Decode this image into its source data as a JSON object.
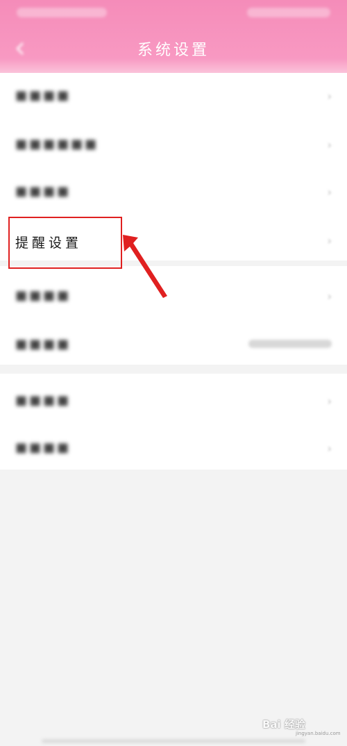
{
  "header": {
    "title": "系统设置",
    "background": "#f899c2"
  },
  "rows": [
    {
      "label": "",
      "has_chevron": true
    },
    {
      "label": "",
      "has_chevron": true
    },
    {
      "label": "",
      "has_chevron": true
    },
    {
      "label": "提醒设置",
      "has_chevron": true,
      "highlighted": true
    },
    {
      "label": "",
      "has_chevron": true
    },
    {
      "label": "",
      "has_value": true
    },
    {
      "label": "",
      "has_chevron": true
    },
    {
      "label": "",
      "has_chevron": true
    }
  ],
  "annotation": {
    "box_color": "#e02020",
    "arrow_color": "#e02020"
  },
  "watermark": {
    "text": "Bai 经验",
    "sub": "jingyan.baidu.com"
  },
  "icons": {
    "back": "back-arrow-icon",
    "chevron": "chevron-right-icon"
  }
}
